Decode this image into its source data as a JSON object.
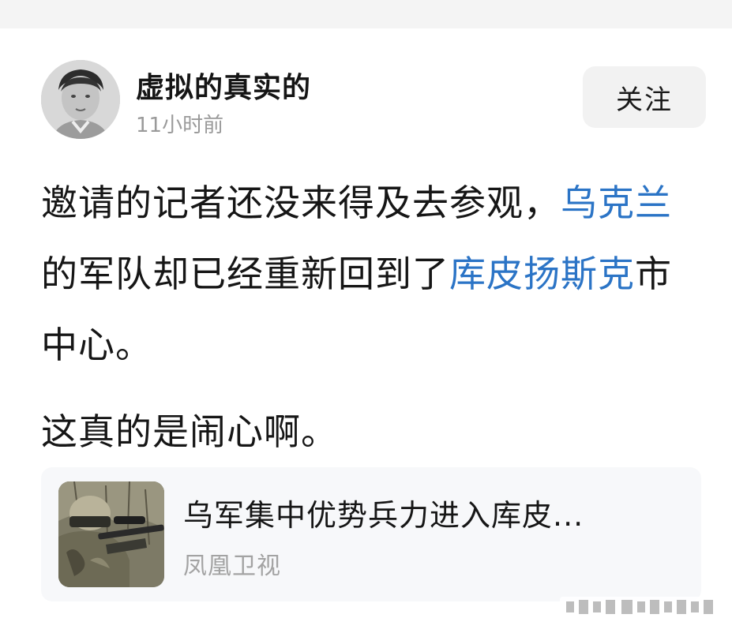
{
  "author": {
    "name": "虚拟的真实的",
    "time": "11小时前",
    "avatar_icon": "avatar-photo"
  },
  "follow": {
    "label": "关注"
  },
  "post": {
    "paragraph1": [
      {
        "text": "邀请的记者还没来得及去参观，",
        "type": "text"
      },
      {
        "text": "乌克兰",
        "type": "link"
      },
      {
        "text": "的军队却已经重新回到了",
        "type": "text"
      },
      {
        "text": "库皮扬斯克",
        "type": "link"
      },
      {
        "text": "市中心。",
        "type": "text"
      }
    ],
    "paragraph2": "这真的是闹心啊。"
  },
  "card": {
    "title": "乌军集中优势兵力进入库皮...",
    "source": "凤凰卫视",
    "thumbnail_icon": "soldier-photo"
  },
  "colors": {
    "link": "#2b74c6",
    "text": "#161616",
    "muted": "#9a9a9a",
    "card_bg": "#f7f8fa",
    "follow_bg": "#f2f2f2"
  }
}
